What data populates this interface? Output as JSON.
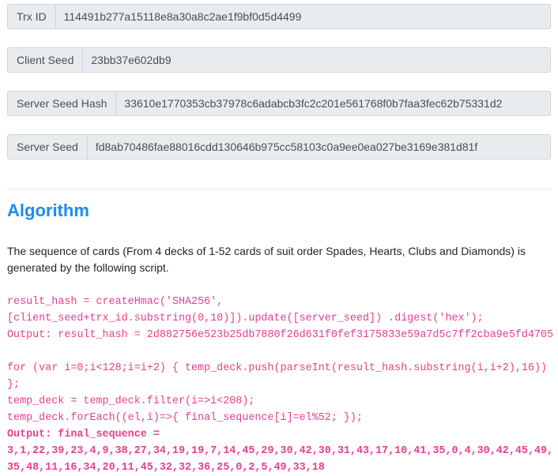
{
  "fields": {
    "trx_id": {
      "label": "Trx ID",
      "value": "114491b277a15118e8a30a8c2ae1f9bf0d5d4499"
    },
    "client_seed": {
      "label": "Client Seed",
      "value": "23bb37e602db9"
    },
    "server_seed_hash": {
      "label": "Server Seed Hash",
      "value": "33610e1770353cb37978c6adabcb3fc2c201e561768f0b7faa3fec62b75331d2"
    },
    "server_seed": {
      "label": "Server Seed",
      "value": "fd8ab70486fae88016cdd130646b975cc58103c0a9ee0ea027be3169e381d81f"
    }
  },
  "algorithm": {
    "title": "Algorithm",
    "description": "The sequence of cards (From 4 decks of 1-52 cards of suit order Spades, Hearts, Clubs and Diamonds) is generated by the following script.",
    "code1": "result_hash = createHmac('SHA256',\n[client_seed+trx_id.substring(0,10)]).update([server_seed]) .digest('hex');\nOutput: result_hash = 2d882756e523b25db7880f26d631f0fef3175833e59a7d5c7ff2cba9e5fd4705",
    "code2": "for (var i=0;i<128;i=i+2) { temp_deck.push(parseInt(result_hash.substring(i,i+2),16))\n};\ntemp_deck = temp_deck.filter(i=>i<208);\ntemp_deck.forEach((el,i)=>{ final_sequence[i]=el%52; });",
    "output_label": "Output: final_sequence =",
    "output_line1": "3,1,22,39,23,4,9,38,27,34,19,19,7,14,45,29,30,42,30,31,43,17,10,41,35,0,4,30,42,45,49,",
    "output_line2": "35,48,11,16,34,20,11,45,32,32,36,25,0,2,5,49,33,18"
  }
}
